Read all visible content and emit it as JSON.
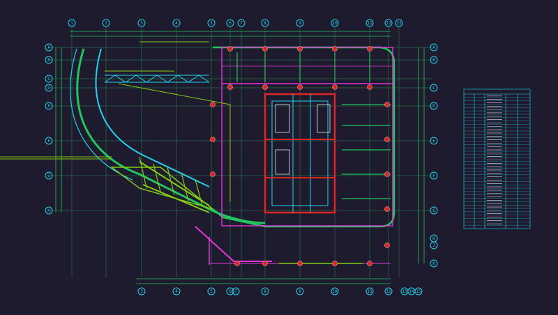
{
  "drawing": {
    "background": "#1f1b2e",
    "colors": {
      "grid": "#22c55e",
      "bubble": "#22d3ee",
      "wall": "#e536d9",
      "core": "#dc2626",
      "column": "#dc2626",
      "truss": "#84cc16",
      "accent": "#facc15",
      "table": "#22d3ee",
      "tag": "#84cc16"
    },
    "axes": {
      "top_labels": [
        "1",
        "2",
        "3",
        "4",
        "5",
        "6",
        "7",
        "8",
        "9",
        "10",
        "11",
        "12",
        "13",
        "14",
        "15"
      ],
      "bottom_labels": [
        "3",
        "4",
        "5",
        "6",
        "7",
        "8",
        "9",
        "10",
        "11",
        "12",
        "13",
        "14",
        "15"
      ],
      "left_labels": [
        "A",
        "B",
        "C",
        "D",
        "E",
        "F",
        "G",
        "H"
      ],
      "right_labels": [
        "A",
        "B",
        "C",
        "D",
        "E",
        "F",
        "G",
        "H",
        "J",
        "K"
      ],
      "lower_left_labels": [
        "L",
        "M",
        "N"
      ],
      "lower_right_labels": [
        "L",
        "M",
        "N"
      ]
    },
    "schedule_table": {
      "title": "",
      "rows": 40
    },
    "icons": {
      "column": "column-marker-icon",
      "axis_bubble": "axis-bubble-icon"
    }
  }
}
